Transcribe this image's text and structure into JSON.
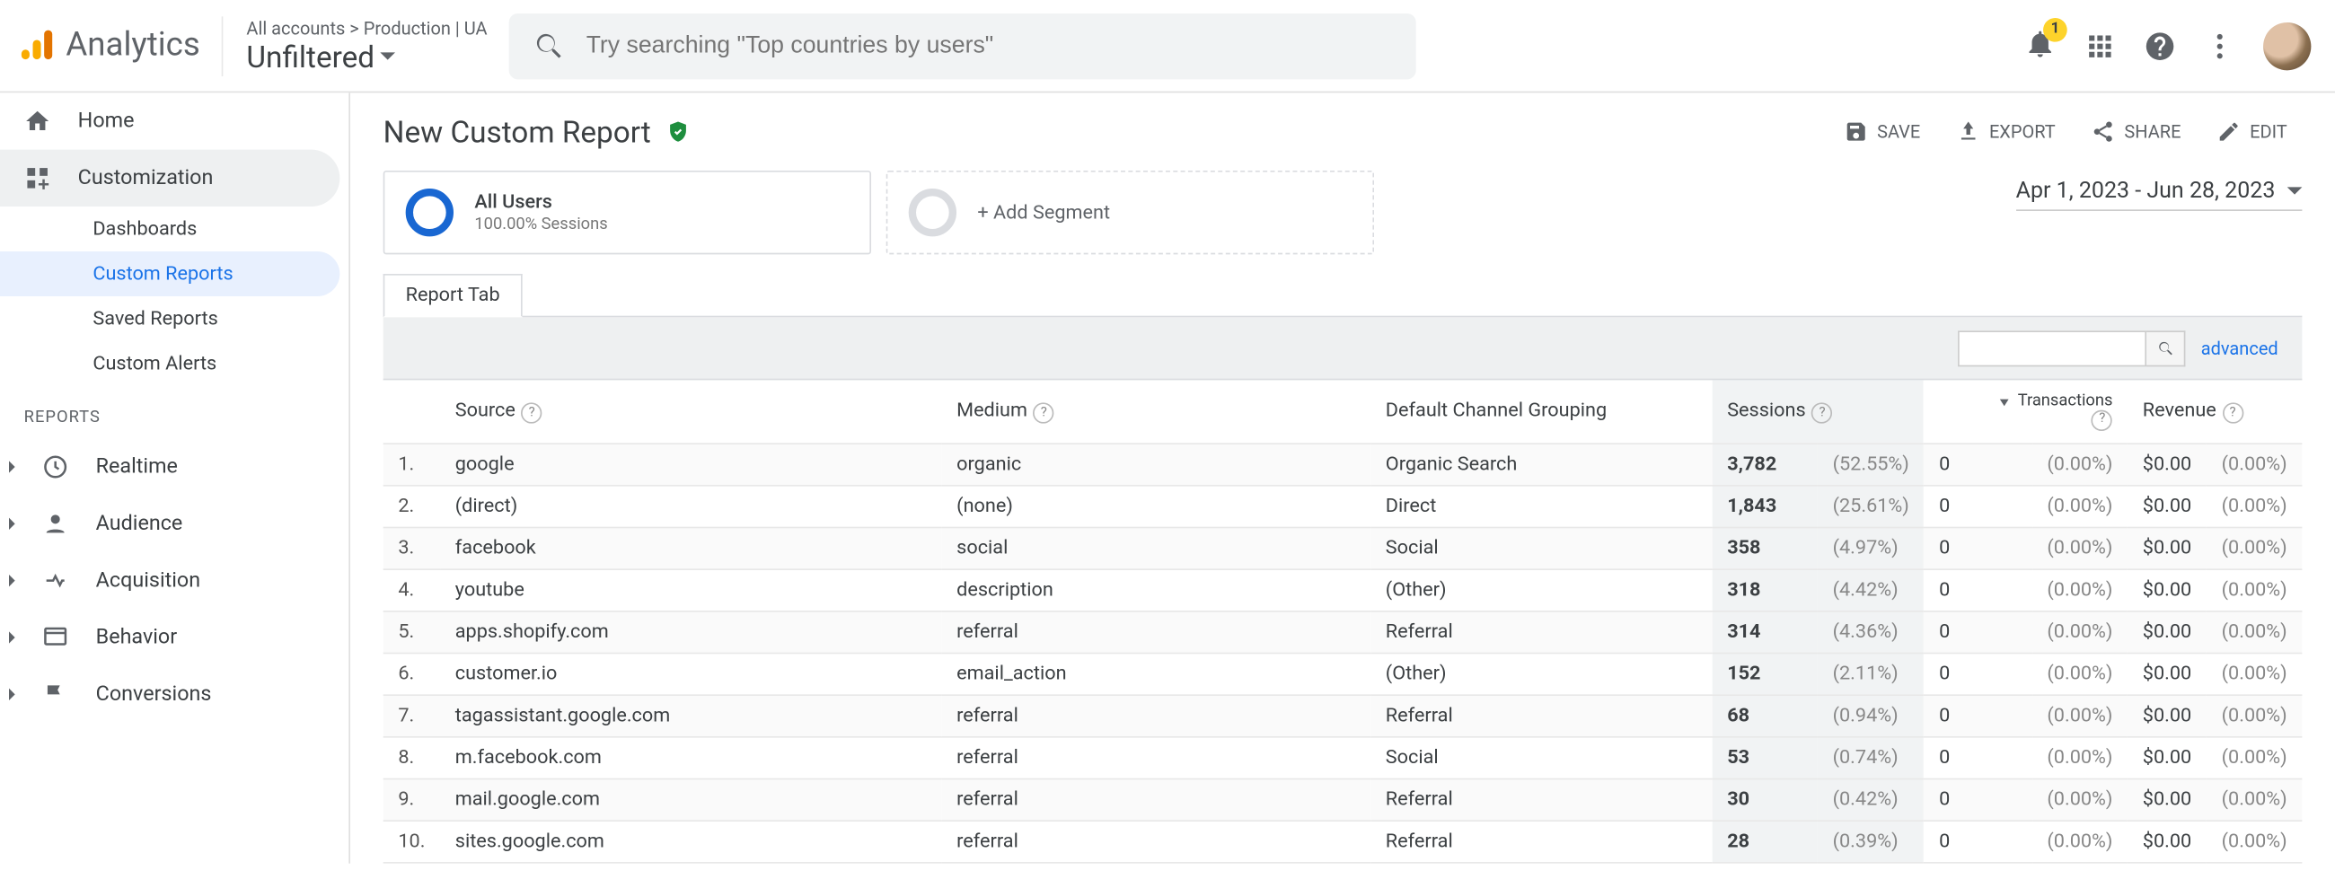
{
  "app": {
    "name": "Analytics",
    "breadcrumb": "All accounts > Production | UA",
    "view": "Unfiltered",
    "search_placeholder": "Try searching \"Top countries by users\"",
    "notif_count": "1"
  },
  "sidebar": {
    "home": "Home",
    "customization": "Customization",
    "sub": {
      "dashboards": "Dashboards",
      "custom_reports": "Custom Reports",
      "saved_reports": "Saved Reports",
      "custom_alerts": "Custom Alerts"
    },
    "reports_label": "REPORTS",
    "realtime": "Realtime",
    "audience": "Audience",
    "acquisition": "Acquisition",
    "behavior": "Behavior",
    "conversions": "Conversions"
  },
  "report": {
    "title": "New Custom Report",
    "actions": {
      "save": "SAVE",
      "export": "EXPORT",
      "share": "SHARE",
      "edit": "EDIT"
    },
    "segment": {
      "name": "All Users",
      "sub": "100.00% Sessions",
      "add": "+ Add Segment"
    },
    "date_range": "Apr 1, 2023 - Jun 28, 2023",
    "tab": "Report Tab",
    "advanced": "advanced"
  },
  "table": {
    "headers": {
      "source": "Source",
      "medium": "Medium",
      "group": "Default Channel Grouping",
      "sessions": "Sessions",
      "transactions": "Transactions",
      "revenue": "Revenue"
    },
    "rows": [
      {
        "idx": "1.",
        "source": "google",
        "medium": "organic",
        "group": "Organic Search",
        "sessions": "3,782",
        "spct": "(52.55%)",
        "trans": "0",
        "tpct": "(0.00%)",
        "rev": "$0.00",
        "rpct": "(0.00%)"
      },
      {
        "idx": "2.",
        "source": "(direct)",
        "medium": "(none)",
        "group": "Direct",
        "sessions": "1,843",
        "spct": "(25.61%)",
        "trans": "0",
        "tpct": "(0.00%)",
        "rev": "$0.00",
        "rpct": "(0.00%)"
      },
      {
        "idx": "3.",
        "source": "facebook",
        "medium": "social",
        "group": "Social",
        "sessions": "358",
        "spct": "(4.97%)",
        "trans": "0",
        "tpct": "(0.00%)",
        "rev": "$0.00",
        "rpct": "(0.00%)"
      },
      {
        "idx": "4.",
        "source": "youtube",
        "medium": "description",
        "group": "(Other)",
        "sessions": "318",
        "spct": "(4.42%)",
        "trans": "0",
        "tpct": "(0.00%)",
        "rev": "$0.00",
        "rpct": "(0.00%)"
      },
      {
        "idx": "5.",
        "source": "apps.shopify.com",
        "medium": "referral",
        "group": "Referral",
        "sessions": "314",
        "spct": "(4.36%)",
        "trans": "0",
        "tpct": "(0.00%)",
        "rev": "$0.00",
        "rpct": "(0.00%)"
      },
      {
        "idx": "6.",
        "source": "customer.io",
        "medium": "email_action",
        "group": "(Other)",
        "sessions": "152",
        "spct": "(2.11%)",
        "trans": "0",
        "tpct": "(0.00%)",
        "rev": "$0.00",
        "rpct": "(0.00%)"
      },
      {
        "idx": "7.",
        "source": "tagassistant.google.com",
        "medium": "referral",
        "group": "Referral",
        "sessions": "68",
        "spct": "(0.94%)",
        "trans": "0",
        "tpct": "(0.00%)",
        "rev": "$0.00",
        "rpct": "(0.00%)"
      },
      {
        "idx": "8.",
        "source": "m.facebook.com",
        "medium": "referral",
        "group": "Social",
        "sessions": "53",
        "spct": "(0.74%)",
        "trans": "0",
        "tpct": "(0.00%)",
        "rev": "$0.00",
        "rpct": "(0.00%)"
      },
      {
        "idx": "9.",
        "source": "mail.google.com",
        "medium": "referral",
        "group": "Referral",
        "sessions": "30",
        "spct": "(0.42%)",
        "trans": "0",
        "tpct": "(0.00%)",
        "rev": "$0.00",
        "rpct": "(0.00%)"
      },
      {
        "idx": "10.",
        "source": "sites.google.com",
        "medium": "referral",
        "group": "Referral",
        "sessions": "28",
        "spct": "(0.39%)",
        "trans": "0",
        "tpct": "(0.00%)",
        "rev": "$0.00",
        "rpct": "(0.00%)"
      }
    ]
  }
}
